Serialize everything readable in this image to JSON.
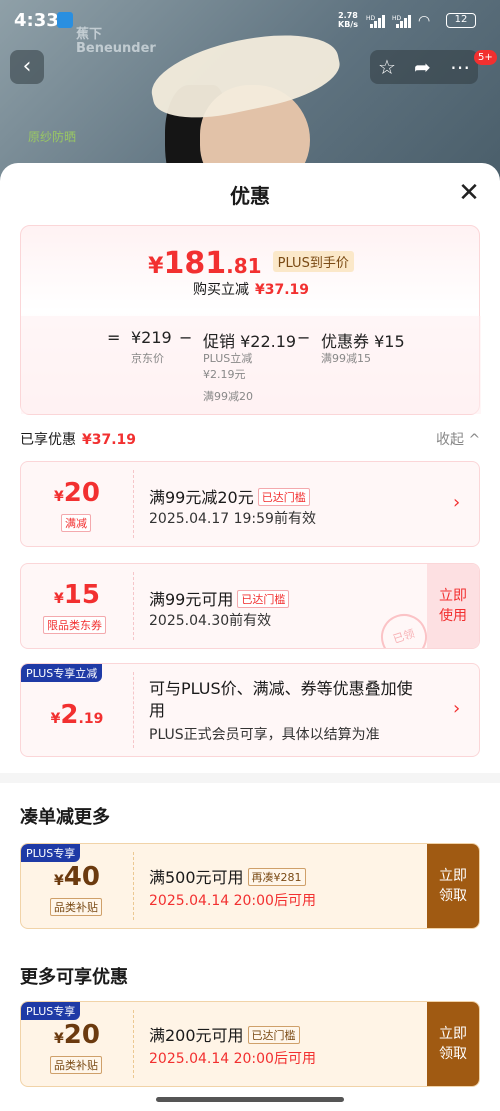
{
  "status": {
    "time": "4:33",
    "speed_value": "2.78",
    "speed_unit": "KB/s",
    "battery": "12"
  },
  "hero": {
    "brand_cn": "蕉下",
    "brand_en": "Beneunder",
    "tagline": "原纱防晒"
  },
  "nav": {
    "back_icon": "back-arrow-icon",
    "star_icon": "star-icon",
    "share_icon": "share-icon",
    "more_icon": "more-icon",
    "badge": "5+"
  },
  "sheet": {
    "title": "优惠",
    "price": {
      "yen": "¥",
      "int": "181",
      "dec": ".81",
      "plus_tag": "PLUS到手价",
      "buy_label": "购买立减",
      "buy_amount": "¥37.19"
    },
    "formula": {
      "eq": "=",
      "jd_price": "¥219",
      "jd_label": "京东价",
      "minus1": "−",
      "promo_value": "促销 ¥22.19",
      "promo_line1": "PLUS立减",
      "promo_line2": "¥2.19元",
      "promo_line3": "满99减20",
      "minus2": "−",
      "coupon_value": "优惠券 ¥15",
      "coupon_line": "满99减15"
    },
    "enjoyed": {
      "label": "已享优惠",
      "amount": "¥37.19",
      "collapse": "收起 ^"
    },
    "coupons": [
      {
        "yen": "¥",
        "amount": "20",
        "tag": "满减",
        "title": "满99元减20元",
        "reach": "已达门槛",
        "sub": "2025.04.17 19:59前有效"
      },
      {
        "yen": "¥",
        "amount": "15",
        "tag": "限品类东券",
        "title": "满99元可用",
        "reach": "已达门槛",
        "sub": "2025.04.30前有效",
        "btn_line1": "立即",
        "btn_line2": "使用",
        "stamp": "已领"
      },
      {
        "label": "PLUS专享立减",
        "yen": "¥",
        "amount": "2",
        "dec": ".19",
        "title_line1": "可与PLUS价、满减、券等优惠叠加使",
        "title_line2": "用",
        "sub": "PLUS正式会员可享，具体以结算为准"
      }
    ],
    "section_more": "凑单减更多",
    "gold1": {
      "label": "PLUS专享",
      "yen": "¥",
      "amount": "40",
      "tag": "品类补贴",
      "title": "满500元可用",
      "extra": "再凑¥281",
      "sub": "2025.04.14 20:00后可用",
      "btn_line1": "立即",
      "btn_line2": "领取"
    },
    "section_extra": "更多可享优惠",
    "gold2": {
      "label": "PLUS专享",
      "yen": "¥",
      "amount": "20",
      "tag": "品类补贴",
      "title": "满200元可用",
      "extra": "已达门槛",
      "sub": "2025.04.14 20:00后可用",
      "btn_line1": "立即",
      "btn_line2": "领取"
    }
  }
}
